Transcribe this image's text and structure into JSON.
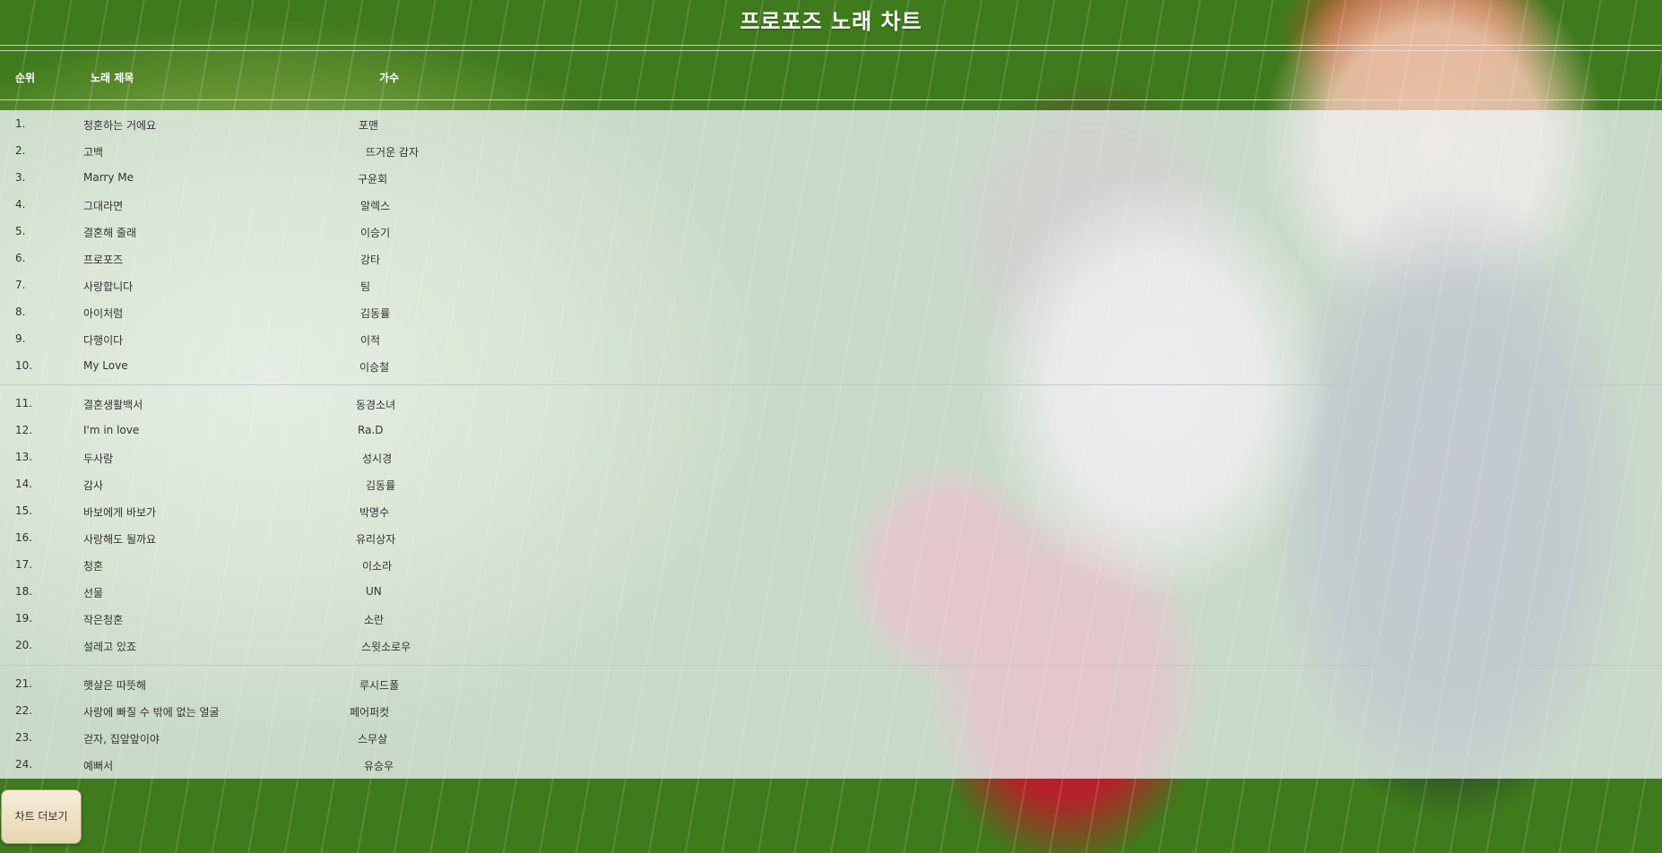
{
  "page": {
    "title": "프로포즈 노래 차트"
  },
  "table": {
    "headers": {
      "rank": "순위",
      "song": "노래 제목",
      "artist": "가수"
    },
    "rows": [
      {
        "rank": "1.",
        "song": "청혼하는 거에요",
        "artist": "포맨"
      },
      {
        "rank": "2.",
        "song": "고백",
        "artist": "뜨거운 감자"
      },
      {
        "rank": "3.",
        "song": "Marry Me",
        "artist": "구윤회"
      },
      {
        "rank": "4.",
        "song": "그대라면",
        "artist": "알렉스"
      },
      {
        "rank": "5.",
        "song": "결혼해 줄래",
        "artist": "이승기"
      },
      {
        "rank": "6.",
        "song": "프로포즈",
        "artist": "강타"
      },
      {
        "rank": "7.",
        "song": "사랑합니다",
        "artist": "팀"
      },
      {
        "rank": "8.",
        "song": "아이처럼",
        "artist": "김동률"
      },
      {
        "rank": "9.",
        "song": "다행이다",
        "artist": "이적"
      },
      {
        "rank": "10.",
        "song": "My Love",
        "artist": "이승철"
      },
      {
        "rank": "11.",
        "song": "결혼생활백서",
        "artist": "동경소녀"
      },
      {
        "rank": "12.",
        "song": "I'm in love",
        "artist": "Ra.D"
      },
      {
        "rank": "13.",
        "song": "두사람",
        "artist": "성시경"
      },
      {
        "rank": "14.",
        "song": "감사",
        "artist": "김동률"
      },
      {
        "rank": "15.",
        "song": "바보에게 바보가",
        "artist": "박명수"
      },
      {
        "rank": "16.",
        "song": "사랑해도 될까요",
        "artist": "유리상자"
      },
      {
        "rank": "17.",
        "song": "청혼",
        "artist": "이소라"
      },
      {
        "rank": "18.",
        "song": "선물",
        "artist": "UN"
      },
      {
        "rank": "19.",
        "song": "작은청혼",
        "artist": "소란"
      },
      {
        "rank": "20.",
        "song": "설레고 있죠",
        "artist": "스윗소로우"
      },
      {
        "rank": "21.",
        "song": "햇살은 따뜻해",
        "artist": "루시드폴"
      },
      {
        "rank": "22.",
        "song": "사랑에 빠질 수 밖에 없는 얼굴",
        "artist": "페어퍼컷"
      },
      {
        "rank": "23.",
        "song": "걷자, 집앞앞이야",
        "artist": "스무살"
      },
      {
        "rank": "24.",
        "song": "예뻐서",
        "artist": "유승우"
      }
    ]
  },
  "more_button": {
    "label": "차트 더보기"
  }
}
